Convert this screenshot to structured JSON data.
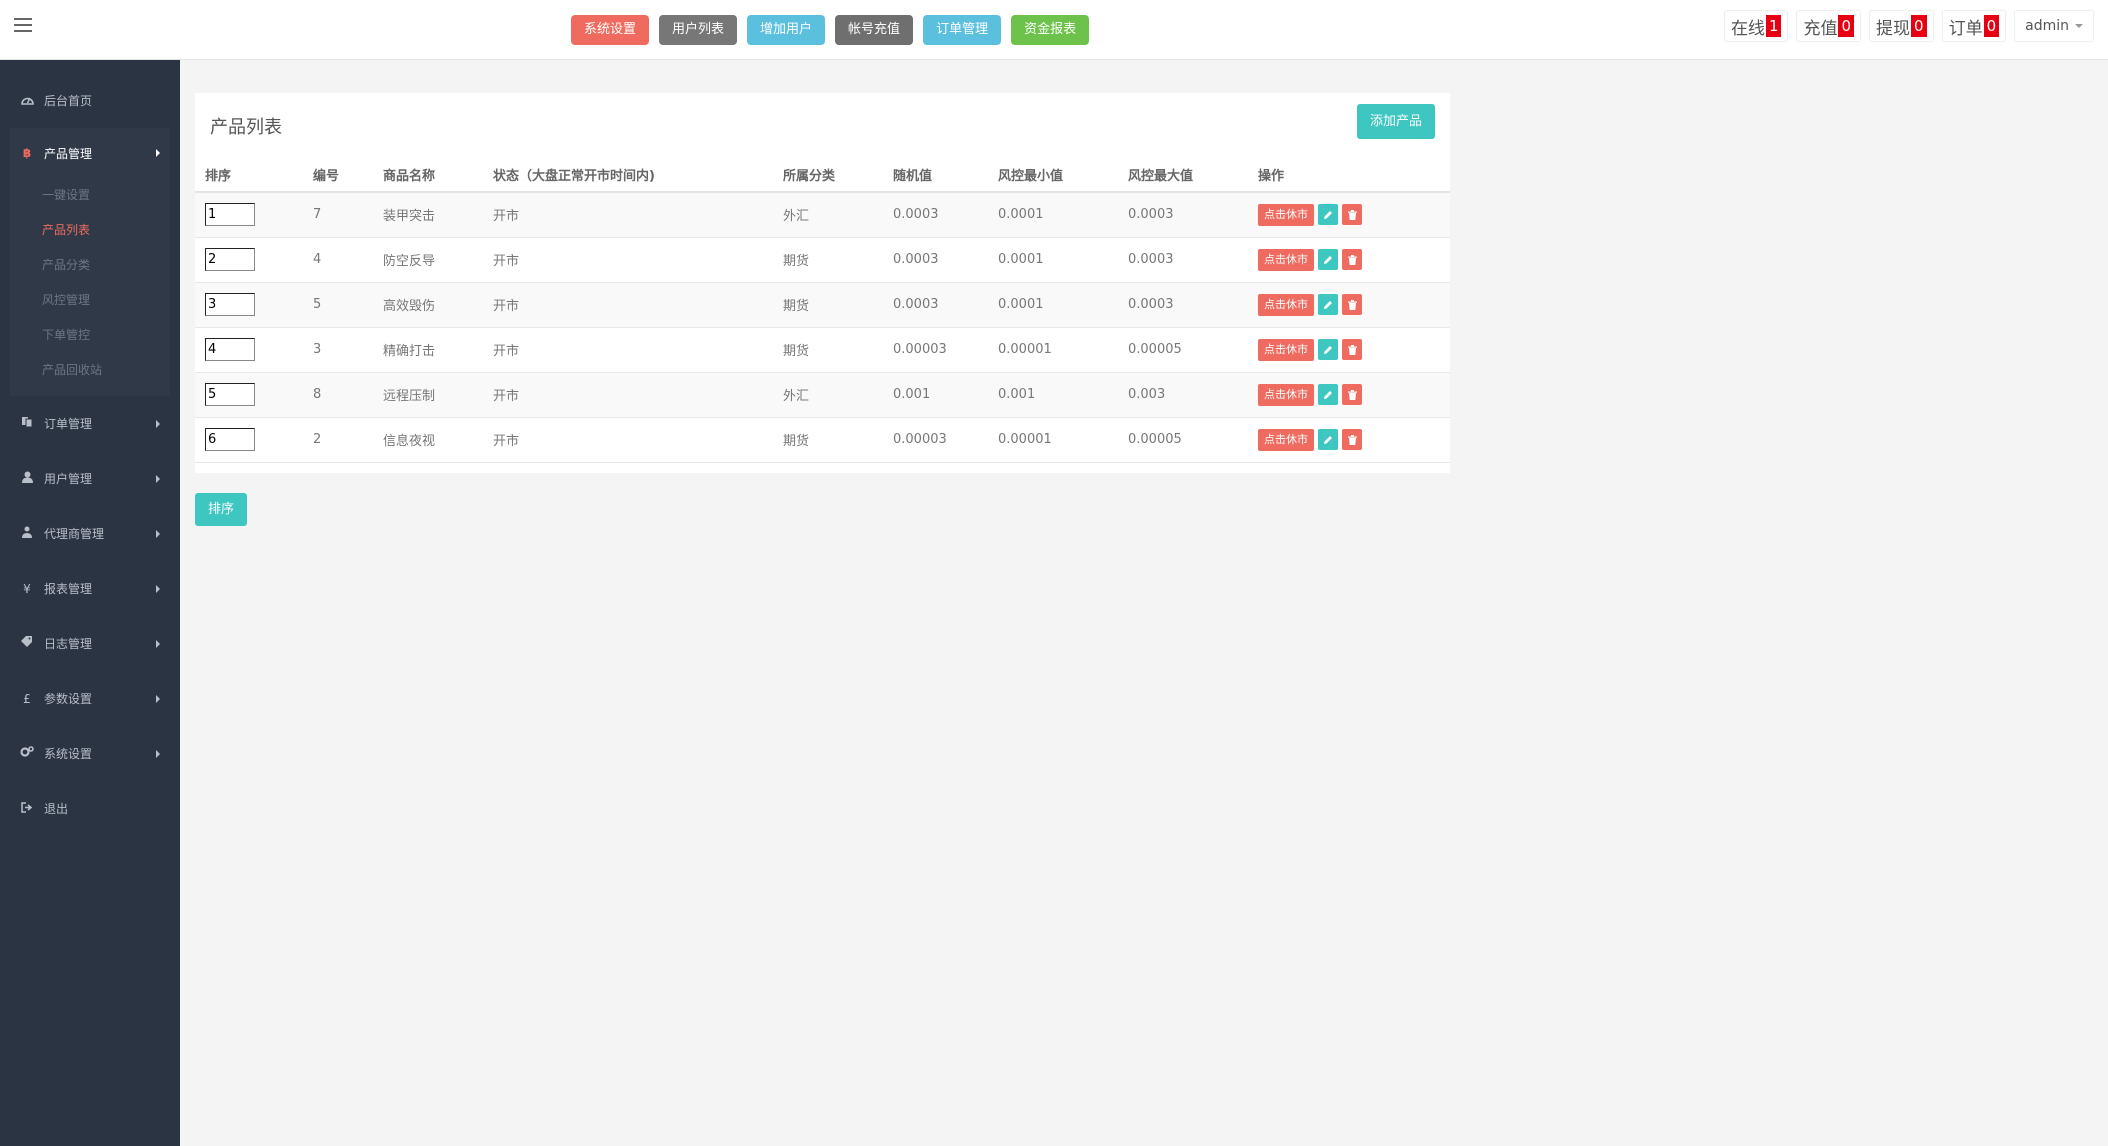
{
  "topnav": [
    {
      "label": "系统设置",
      "color": "#f06b5f"
    },
    {
      "label": "用户列表",
      "color": "#777777"
    },
    {
      "label": "增加用户",
      "color": "#5bc0de"
    },
    {
      "label": "帐号充值",
      "color": "#6f6f6f"
    },
    {
      "label": "订单管理",
      "color": "#5bc0de"
    },
    {
      "label": "资金报表",
      "color": "#6cc24a"
    }
  ],
  "stats": [
    {
      "label": "在线",
      "count": "1"
    },
    {
      "label": "充值",
      "count": "0"
    },
    {
      "label": "提现",
      "count": "0"
    },
    {
      "label": "订单",
      "count": "0"
    }
  ],
  "user": {
    "name": "admin"
  },
  "sidebar": {
    "home": {
      "label": "后台首页",
      "icon": "dashboard-icon"
    },
    "product": {
      "label": "产品管理",
      "icon": "bitcoin-icon",
      "children": [
        "一键设置",
        "产品列表",
        "产品分类",
        "风控管理",
        "下单管控",
        "产品回收站"
      ]
    },
    "items": [
      {
        "label": "订单管理",
        "icon": "copy-icon"
      },
      {
        "label": "用户管理",
        "icon": "user-icon"
      },
      {
        "label": "代理商管理",
        "icon": "sitemap-icon"
      },
      {
        "label": "报表管理",
        "icon": "yen-icon"
      },
      {
        "label": "日志管理",
        "icon": "tags-icon"
      },
      {
        "label": "参数设置",
        "icon": "pound-icon"
      },
      {
        "label": "系统设置",
        "icon": "gears-icon"
      }
    ],
    "logout": {
      "label": "退出",
      "icon": "sign-out-icon"
    }
  },
  "main": {
    "title": "产品列表",
    "add_label": "添加产品",
    "columns": [
      "排序",
      "编号",
      "商品名称",
      "状态（大盘正常开市时间内)",
      "所属分类",
      "随机值",
      "风控最小值",
      "风控最大值",
      "操作"
    ],
    "close_label": "点击休市",
    "sort_label": "排序",
    "rows": [
      {
        "order": "1",
        "id": "7",
        "name": "装甲突击",
        "status": "开市",
        "category": "外汇",
        "random": "0.0003",
        "min": "0.0001",
        "max": "0.0003"
      },
      {
        "order": "2",
        "id": "4",
        "name": "防空反导",
        "status": "开市",
        "category": "期货",
        "random": "0.0003",
        "min": "0.0001",
        "max": "0.0003"
      },
      {
        "order": "3",
        "id": "5",
        "name": "高效毁伤",
        "status": "开市",
        "category": "期货",
        "random": "0.0003",
        "min": "0.0001",
        "max": "0.0003"
      },
      {
        "order": "4",
        "id": "3",
        "name": "精确打击",
        "status": "开市",
        "category": "期货",
        "random": "0.00003",
        "min": "0.00001",
        "max": "0.00005"
      },
      {
        "order": "5",
        "id": "8",
        "name": "远程压制",
        "status": "开市",
        "category": "外汇",
        "random": "0.001",
        "min": "0.001",
        "max": "0.003"
      },
      {
        "order": "6",
        "id": "2",
        "name": "信息夜视",
        "status": "开市",
        "category": "期货",
        "random": "0.00003",
        "min": "0.00001",
        "max": "0.00005"
      }
    ]
  }
}
